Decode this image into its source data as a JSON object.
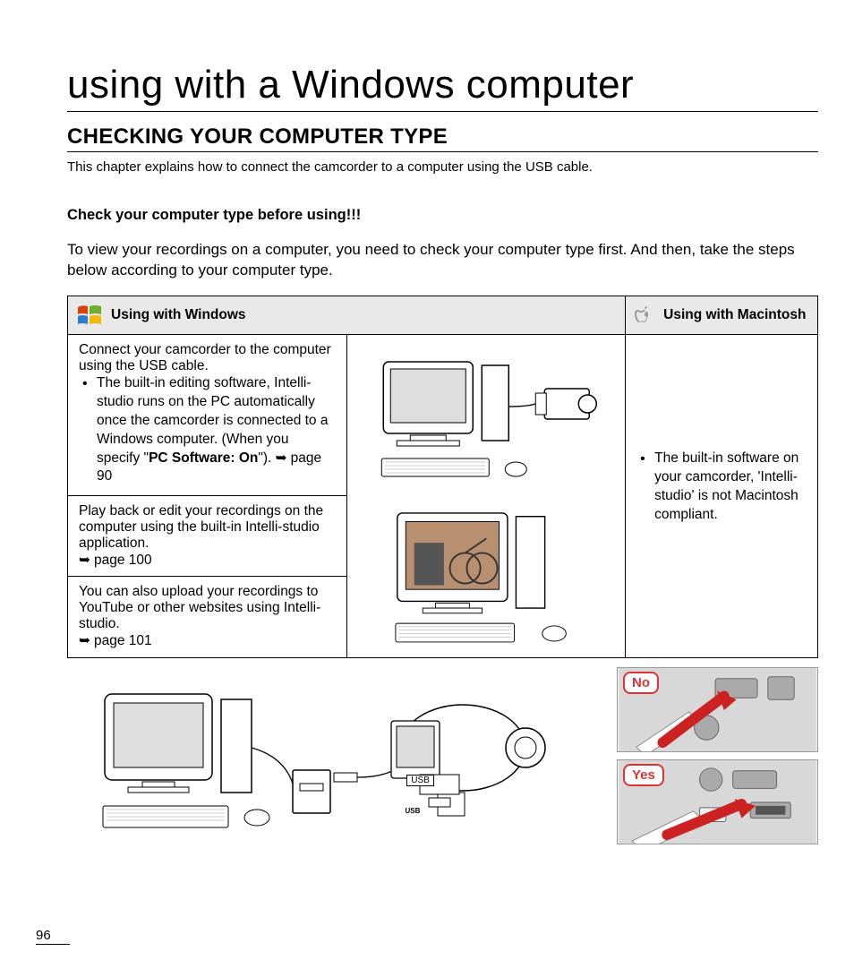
{
  "page_number": "96",
  "title": "using with a Windows computer",
  "section_heading": "CHECKING YOUR COMPUTER TYPE",
  "intro": "This chapter explains how to connect the camcorder to a computer using the USB cable.",
  "subhead": "Check your computer type before using!!!",
  "body": "To view your recordings on a computer, you need to check your computer type first. And then, take the steps below according to your computer type.",
  "table": {
    "win_header": "Using with Windows",
    "mac_header": "Using with Macintosh",
    "win_row1_lead": "Connect your camcorder to the computer using the USB cable.",
    "win_row1_bullet_a": "The built-in editing software, Intelli-studio runs on the PC automatically once the camcorder is connected to a Windows computer. (When you specify \"",
    "win_row1_bullet_bold": "PC Software: On",
    "win_row1_bullet_b": "\"). ",
    "win_row1_ref": "page 90",
    "win_row2": "Play back or edit your recordings on the computer using the built-in Intelli-studio application.",
    "win_row2_ref": "page 100",
    "win_row3": "You can also upload your recordings to YouTube or other websites using Intelli-studio.",
    "win_row3_ref": "page 101",
    "mac_bullet": "The built-in software on your camcorder, 'Intelli-studio' is not Macintosh compliant."
  },
  "diagram": {
    "usb_label": "USB",
    "usb_small": "USB",
    "no_label": "No",
    "yes_label": "Yes"
  }
}
